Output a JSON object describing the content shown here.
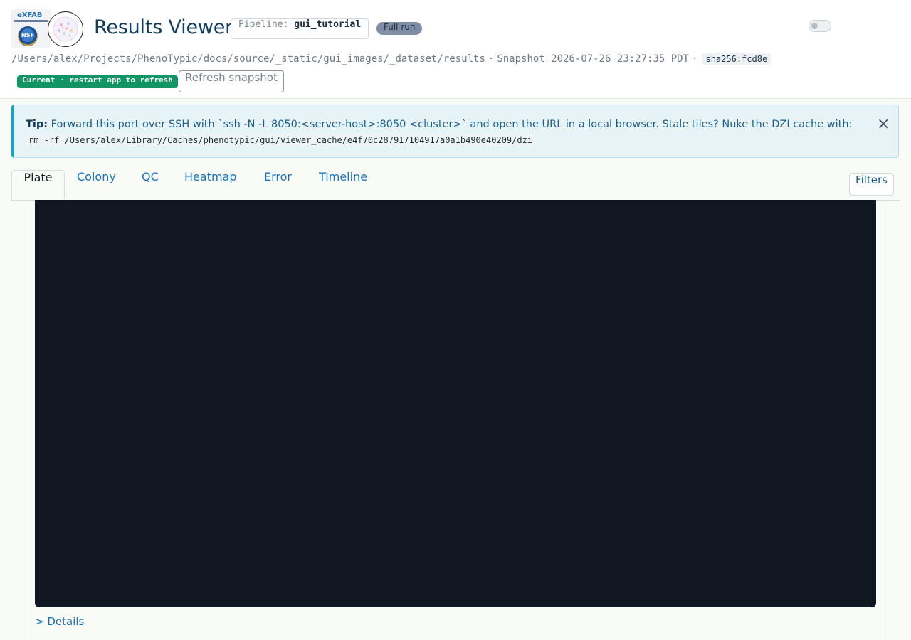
{
  "header": {
    "logo_text": "eXFAB",
    "nsf_text": "NSF",
    "title": "Results Viewer",
    "pipeline_label": "Pipeline:",
    "pipeline_value": "gui_tutorial",
    "run_badge": "Full run",
    "dark_mode_toggle": "off",
    "results_path": "/Users/alex/Projects/PhenoTypic/docs/source/_static/gui_images/_dataset/results",
    "separator": "·",
    "snapshot_text": "Snapshot 2026-07-26 23:27:35 PDT",
    "hash": "sha256:fcd8e",
    "status_badge": "Current · restart app to refresh",
    "refresh_button": "Refresh snapshot"
  },
  "tip": {
    "label": "Tip:",
    "message": "Forward this port over SSH with `ssh -N -L 8050:<server-host>:8050 <cluster>` and open the URL in a local browser. Stale tiles? Nuke the DZI cache with:",
    "command": "rm -rf /Users/alex/Library/Caches/phenotypic/gui/viewer_cache/e4f70c287917104917a0a1b490e40209/dzi",
    "close_symbol": "×"
  },
  "tabs": [
    {
      "label": "Plate",
      "active": true
    },
    {
      "label": "Colony",
      "active": false
    },
    {
      "label": "QC",
      "active": false
    },
    {
      "label": "Heatmap",
      "active": false
    },
    {
      "label": "Error",
      "active": false
    },
    {
      "label": "Timeline",
      "active": false
    }
  ],
  "filters_button": "Filters",
  "details_toggle": "> Details",
  "colors": {
    "title": "#0f3d5e",
    "accent": "#1e73b8",
    "status_green": "#119565",
    "badge_gray": "#7f8ea5",
    "tip_bg": "#e6f3f7",
    "viewer_bg": "#111822"
  }
}
